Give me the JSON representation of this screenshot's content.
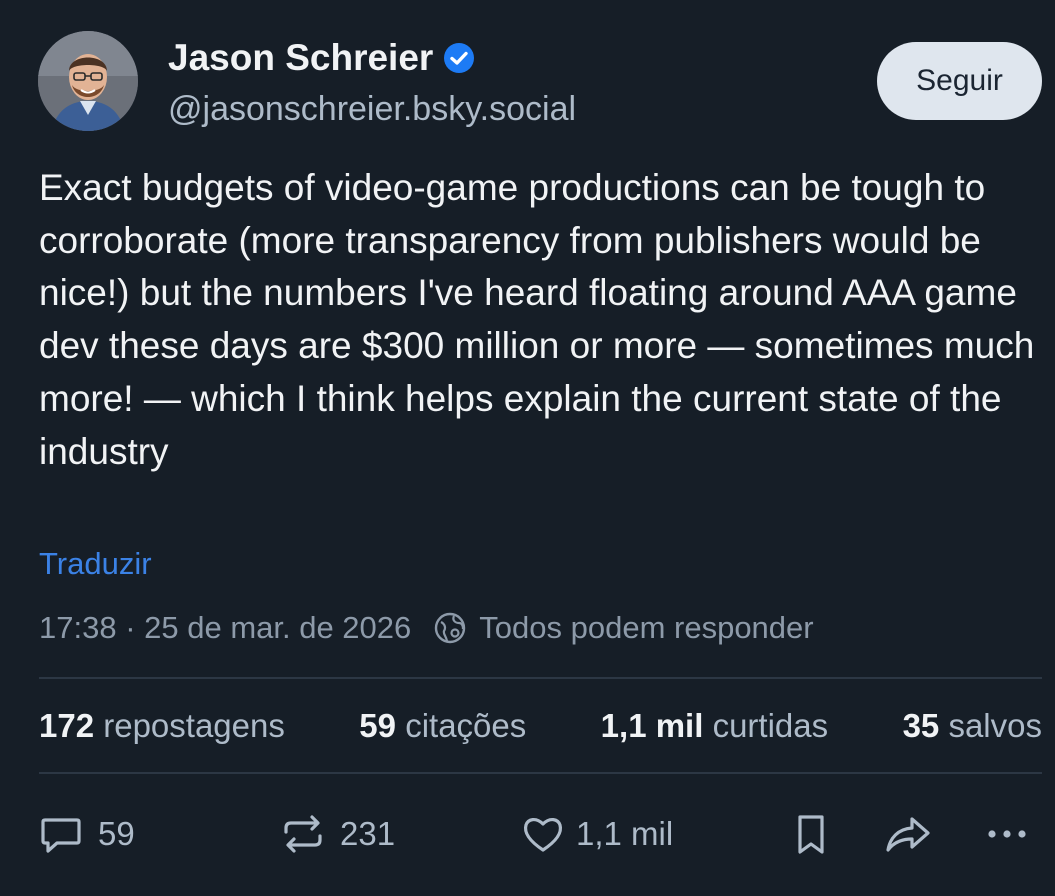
{
  "author": {
    "display_name": "Jason Schreier",
    "handle": "@jasonschreier.bsky.social",
    "verified": true
  },
  "follow_button": {
    "label": "Seguir"
  },
  "post": {
    "text": "Exact budgets of video-game productions can be tough to corroborate (more transparency from publishers would be nice!) but the numbers I've heard floating around AAA game dev these days are $300 million or more — sometimes much more! — which I think helps explain the current state of the industry",
    "translate_label": "Traduzir",
    "timestamp": "17:38 · 25 de mar. de 2026",
    "reply_setting": "Todos podem responder"
  },
  "stats": [
    {
      "value": "172",
      "label": "repostagens"
    },
    {
      "value": "59",
      "label": "citações"
    },
    {
      "value": "1,1 mil",
      "label": "curtidas"
    },
    {
      "value": "35",
      "label": "salvos"
    }
  ],
  "actions": {
    "reply_count": "59",
    "repost_count": "231",
    "like_count": "1,1 mil"
  },
  "colors": {
    "background": "#161e27",
    "accent": "#3b82e6",
    "verified": "#1d7bf5",
    "muted_text": "#aebbc9"
  },
  "icons": {
    "verified": "verified-badge-icon",
    "reply_setting": "globe-icon",
    "reply": "reply-icon",
    "repost": "repost-icon",
    "like": "heart-icon",
    "bookmark": "bookmark-icon",
    "share": "share-icon",
    "more": "more-icon"
  }
}
